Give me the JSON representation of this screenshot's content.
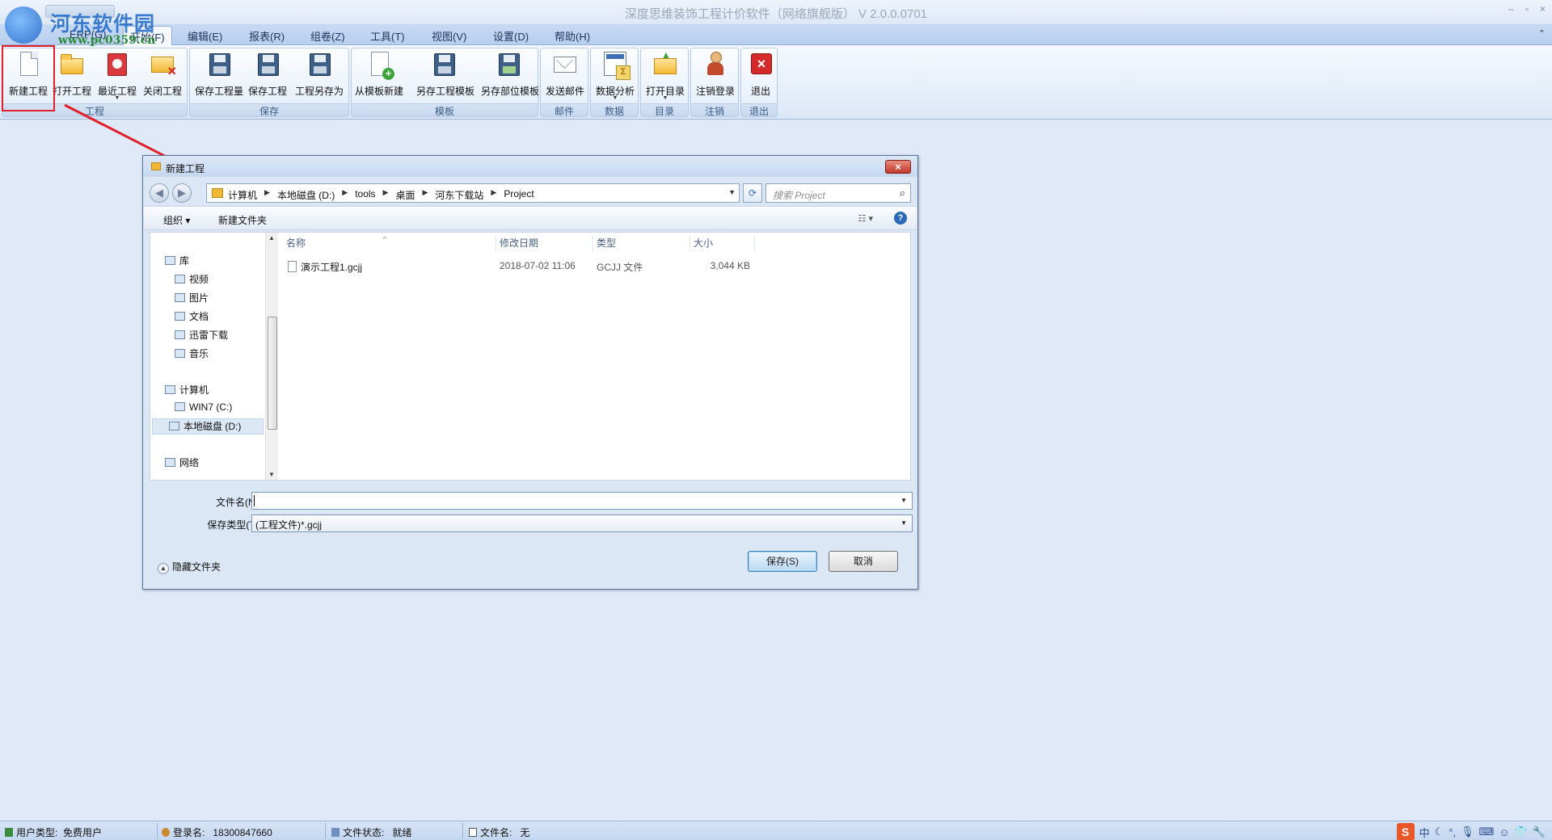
{
  "app": {
    "title": "深度思维装饰工程计价软件（网络旗舰版） V 2.0.0.0701",
    "window_controls": [
      "–",
      "▫",
      "×"
    ]
  },
  "watermark": {
    "title": "河东软件园",
    "url": "www.pc0359.cn"
  },
  "menu": {
    "items": [
      "ERP(G)",
      "开始(F)",
      "编辑(E)",
      "报表(R)",
      "组卷(Z)",
      "工具(T)",
      "视图(V)",
      "设置(D)",
      "帮助(H)"
    ],
    "active": "开始(F)"
  },
  "ribbon": {
    "groups": [
      {
        "label": "工程",
        "buttons": [
          "新建工程",
          "打开工程",
          "最近工程",
          "关闭工程"
        ]
      },
      {
        "label": "保存",
        "buttons": [
          "保存工程量",
          "保存工程",
          "工程另存为"
        ]
      },
      {
        "label": "模板",
        "buttons": [
          "从模板新建",
          "另存工程模板",
          "另存部位模板"
        ]
      },
      {
        "label": "邮件",
        "buttons": [
          "发送邮件"
        ]
      },
      {
        "label": "数据",
        "buttons": [
          "数据分析"
        ]
      },
      {
        "label": "目录",
        "buttons": [
          "打开目录"
        ]
      },
      {
        "label": "注销",
        "buttons": [
          "注销登录"
        ]
      },
      {
        "label": "退出",
        "buttons": [
          "退出"
        ]
      }
    ],
    "highlighted_button": "新建工程",
    "accent": "#e0202a"
  },
  "dialog": {
    "title": "新建工程",
    "close_label": "×",
    "breadcrumbs": [
      "计算机",
      "本地磁盘 (D:)",
      "tools",
      "桌面",
      "河东下载站",
      "Project"
    ],
    "search_placeholder": "搜索 Project",
    "commands": {
      "organize": "组织 ▾",
      "new_folder": "新建文件夹"
    },
    "nav": {
      "libraries": {
        "label": "库",
        "items": [
          "视频",
          "图片",
          "文档",
          "迅雷下载",
          "音乐"
        ]
      },
      "computer": {
        "label": "计算机",
        "items": [
          "WIN7 (C:)",
          "本地磁盘 (D:)"
        ],
        "selected": "本地磁盘 (D:)"
      },
      "network": {
        "label": "网络"
      }
    },
    "columns": [
      "名称",
      "修改日期",
      "类型",
      "大小"
    ],
    "files": [
      {
        "name": "演示工程1.gcjj",
        "modified": "2018-07-02 11:06",
        "type": "GCJJ 文件",
        "size": "3,044 KB"
      }
    ],
    "filename_label": "文件名(N):",
    "filename_value": "",
    "filetype_label": "保存类型(T):",
    "filetype_value": "(工程文件)*.gcjj",
    "save_button": "保存(S)",
    "cancel_button": "取消",
    "hide_folders": "隐藏文件夹"
  },
  "status": {
    "user_type_label": "用户类型:",
    "user_type_value": "免费用户",
    "login_label": "登录名:",
    "login_value": "18300847660",
    "file_state_label": "文件状态:",
    "file_state_value": "就绪",
    "file_name_label": "文件名:",
    "file_name_value": "无"
  },
  "ime": {
    "logo": "S",
    "mode": "中"
  }
}
